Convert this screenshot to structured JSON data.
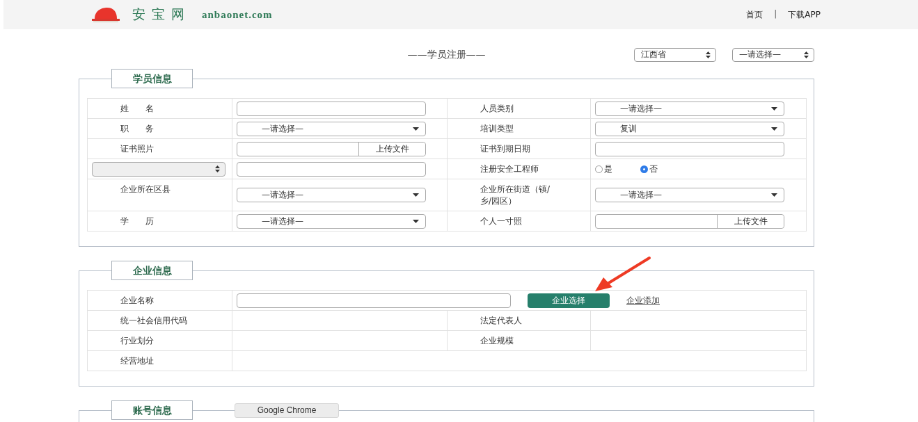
{
  "header": {
    "brand": "安宝网",
    "domain": "anbaonet.com",
    "nav": [
      {
        "kind": "link",
        "text": "首页"
      },
      {
        "kind": "separator",
        "text": "|"
      },
      {
        "kind": "link",
        "text": "下载APP"
      }
    ]
  },
  "title": "——学员注册——",
  "region_selects": [
    {
      "value": "江西省"
    },
    {
      "value": "—请选择—"
    }
  ],
  "sections": [
    {
      "title": "学员信息",
      "rows": [
        [
          {
            "kind": "label",
            "text": "姓　　名"
          },
          {
            "kind": "input"
          },
          {
            "kind": "label",
            "text": "人员类别"
          },
          {
            "kind": "select",
            "value": "—请选择—"
          }
        ],
        [
          {
            "kind": "label",
            "text": "职　　务"
          },
          {
            "kind": "select",
            "value": "—请选择—"
          },
          {
            "kind": "label",
            "text": "培训类型"
          },
          {
            "kind": "select",
            "value": "复训"
          }
        ],
        [
          {
            "kind": "label",
            "text": "证书照片"
          },
          {
            "kind": "upload",
            "button": "上传文件"
          },
          {
            "kind": "label",
            "text": "证书到期日期"
          },
          {
            "kind": "input"
          }
        ],
        [
          {
            "kind": "picker",
            "disabled": true
          },
          {
            "kind": "input"
          },
          {
            "kind": "label",
            "text": "注册安全工程师"
          },
          {
            "kind": "radio",
            "options": [
              {
                "label": "是",
                "selected": false
              },
              {
                "label": "否",
                "selected": true
              }
            ]
          }
        ],
        [
          {
            "kind": "label",
            "text": "企业所在区县"
          },
          {
            "kind": "select",
            "value": "—请选择—"
          },
          {
            "kind": "label",
            "text": "企业所在街道（镇/乡/园区）"
          },
          {
            "kind": "select",
            "value": "—请选择—"
          }
        ],
        [
          {
            "kind": "label",
            "text": "学　　历"
          },
          {
            "kind": "select",
            "value": "—请选择—"
          },
          {
            "kind": "label",
            "text": "个人一寸照"
          },
          {
            "kind": "upload",
            "button": "上传文件"
          }
        ]
      ]
    },
    {
      "title": "企业信息",
      "rows": [
        [
          {
            "kind": "label",
            "text": "企业名称"
          },
          {
            "kind": "company",
            "button": "企业选择",
            "link": "企业添加",
            "colspan": 3
          }
        ],
        [
          {
            "kind": "label",
            "text": "统一社会信用代码"
          },
          {
            "kind": "blank"
          },
          {
            "kind": "label",
            "text": "法定代表人"
          },
          {
            "kind": "blank"
          }
        ],
        [
          {
            "kind": "label",
            "text": "行业划分"
          },
          {
            "kind": "blank"
          },
          {
            "kind": "label",
            "text": "企业规模"
          },
          {
            "kind": "blank"
          }
        ],
        [
          {
            "kind": "label",
            "text": "经营地址"
          },
          {
            "kind": "blank",
            "colspan": 3
          }
        ]
      ]
    },
    {
      "title": "账号信息"
    }
  ],
  "tooltip": "Google Chrome"
}
